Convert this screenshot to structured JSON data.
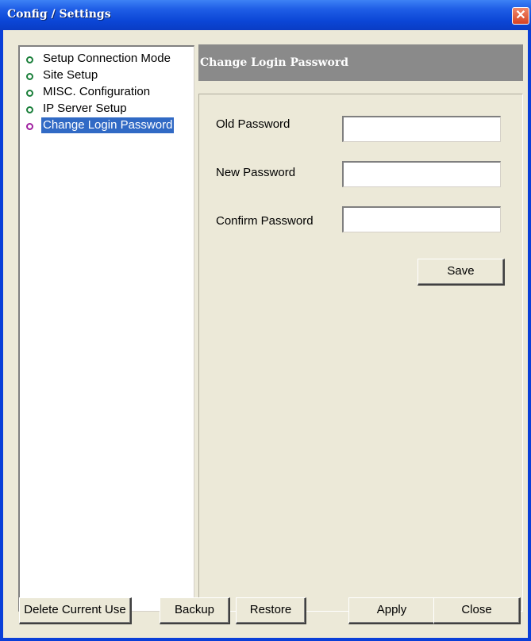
{
  "window": {
    "title": "Config / Settings",
    "close_label": "✕"
  },
  "tree": {
    "items": [
      {
        "label": "Setup Connection Mode",
        "selected": false
      },
      {
        "label": "Site Setup",
        "selected": false
      },
      {
        "label": "MISC. Configuration",
        "selected": false
      },
      {
        "label": "IP Server Setup",
        "selected": false
      },
      {
        "label": "Change Login Password",
        "selected": true
      }
    ]
  },
  "panel": {
    "title": "Change Login Password",
    "fields": {
      "old_label": "Old Password",
      "old_value": "",
      "new_label": "New Password",
      "new_value": "",
      "confirm_label": "Confirm Password",
      "confirm_value": ""
    },
    "save_label": "Save"
  },
  "footer": {
    "delete_label": "Delete Current Use",
    "backup_label": "Backup",
    "restore_label": "Restore",
    "apply_label": "Apply",
    "close_label": "Close"
  },
  "colors": {
    "titlebar": "#0b46d6",
    "selection": "#316ac5",
    "panel_header": "#8a8a8a",
    "dialog_bg": "#ece9d8"
  }
}
